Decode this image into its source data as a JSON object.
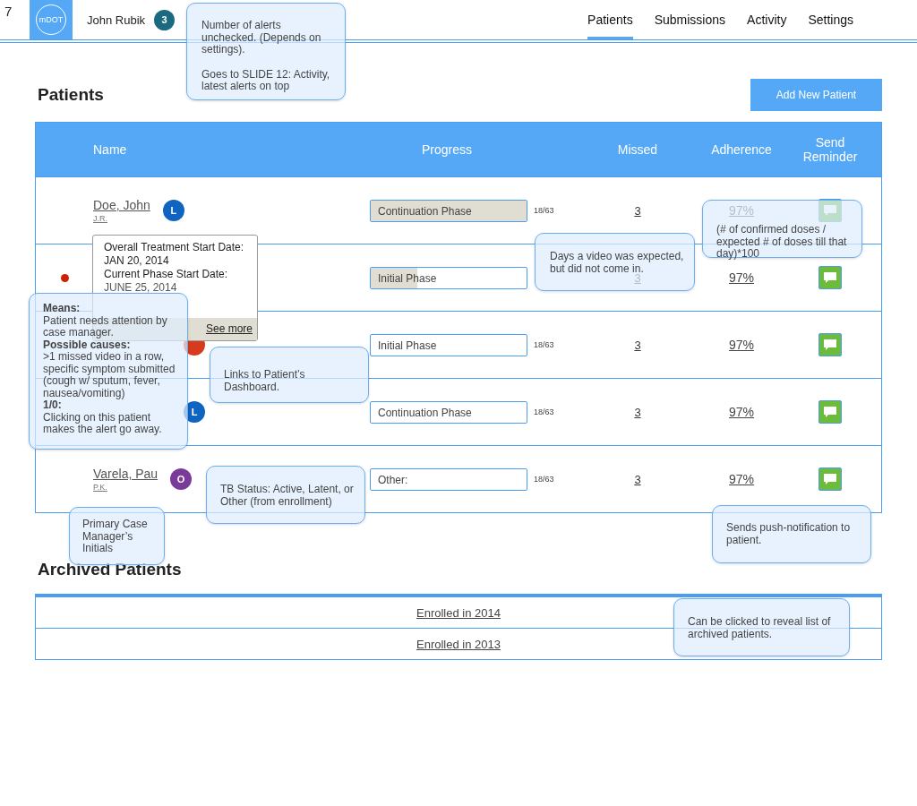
{
  "slide_number": "7",
  "header": {
    "logo": "mDOT",
    "user": "John Rubik",
    "alert_count": "3",
    "nav": [
      {
        "label": "Patients",
        "selected": true
      },
      {
        "label": "Submissions",
        "selected": false
      },
      {
        "label": "Activity",
        "selected": false
      },
      {
        "label": "Settings",
        "selected": false
      }
    ]
  },
  "patients": {
    "title": "Patients",
    "add_button": "Add New Patient",
    "columns": [
      "Name",
      "Progress",
      "Missed",
      "Adherence",
      "Send Reminder"
    ],
    "rows": [
      {
        "name": "Doe, John",
        "initials": "J.R.",
        "status": "L",
        "color": "#0e64c0",
        "alert": false,
        "phase": "Continuation Phase",
        "level": 1,
        "count": "18/63",
        "missed": "3",
        "adherence": "97%"
      },
      {
        "alert": true,
        "phase": "Initial Phase",
        "level": 0.3,
        "missed": "3",
        "adherence": "97%"
      },
      {
        "color": "#d83a1e",
        "alert": false,
        "phase": "Initial Phase",
        "level": 0,
        "count": "18/63",
        "missed": "3",
        "adherence": "97%"
      },
      {
        "status": "L",
        "color": "#0e64c0",
        "alert": false,
        "phase": "Continuation Phase",
        "level": 0,
        "count": "18/63",
        "missed": "3",
        "adherence": "97%"
      },
      {
        "name": "Varela, Pau",
        "initials": "P.K.",
        "status": "O",
        "color": "#7a3a9a",
        "alert": false,
        "phase": "Other:",
        "level": 0,
        "count": "18/63",
        "missed": "3",
        "adherence": "97%"
      }
    ]
  },
  "treatment_popup": {
    "lines": [
      "Overall Treatment Start Date:",
      "JAN 20, 2014",
      "Current Phase Start Date:",
      "JUNE 25, 2014"
    ],
    "link": "See more"
  },
  "archived": {
    "title": "Archived Patients",
    "items": [
      "Enrolled in 2014",
      "Enrolled in 2013"
    ]
  },
  "callouts": [
    {
      "lines": [
        "Number of alerts unchecked. (Depends on settings).",
        "Goes to SLIDE 12: Activity, latest alerts on top"
      ]
    },
    {
      "lines": [
        "**Means:**",
        "Patient needs attention by case manager.",
        "**Possible causes:**",
        ">1 missed video in a row, specific symptom submitted (cough w/ sputum, fever, nausea/vomiting)",
        "**1/0:**",
        "Clicking on this patient makes the alert go away."
      ]
    },
    {
      "lines": [
        "Links to Patient’s Dashboard."
      ]
    },
    {
      "lines": [
        "Days a video was expected, but did not come in."
      ]
    },
    {
      "lines": [
        "(# of confirmed doses / expected # of doses till that day)*100"
      ]
    },
    {
      "lines": [
        "TB Status: Active, Latent, or Other (from enrollment)"
      ]
    },
    {
      "lines": [
        "Primary Case Manager’s Initials"
      ]
    },
    {
      "lines": [
        "Sends push-notification to patient."
      ]
    },
    {
      "lines": [
        "Can be clicked to reveal list of archived patients."
      ]
    }
  ]
}
